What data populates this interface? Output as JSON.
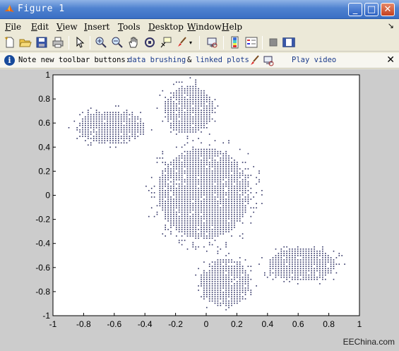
{
  "window": {
    "title": "Figure 1"
  },
  "menu": {
    "items": [
      "File",
      "Edit",
      "View",
      "Insert",
      "Tools",
      "Desktop",
      "Window",
      "Help"
    ]
  },
  "toolbar": {
    "icons": [
      "new-file-icon",
      "open-folder-icon",
      "save-icon",
      "print-icon",
      "pointer-arrow-icon",
      "zoom-in-icon",
      "zoom-out-icon",
      "pan-hand-icon",
      "rotate-3d-icon",
      "data-cursor-icon",
      "brush-icon",
      "link-plot-icon",
      "colorbar-icon",
      "legend-icon",
      "hide-plot-tools-icon",
      "show-plot-tools-icon"
    ]
  },
  "infobar": {
    "prefix": "Note new toolbar buttons:",
    "link1": "data brushing",
    "amp": "&",
    "link2": "linked plots",
    "link3": "Play video"
  },
  "colors": {
    "dots": "#2c2f62",
    "figure_bg": "#cccccc",
    "axes_bg": "#ffffff"
  },
  "chart_data": {
    "type": "scatter",
    "title": "",
    "xlabel": "",
    "ylabel": "",
    "xlim": [
      -1,
      1
    ],
    "ylim": [
      -1,
      1
    ],
    "xticks": [
      "-1",
      "-0.8",
      "-0.6",
      "-0.4",
      "-0.2",
      "0",
      "0.2",
      "0.4",
      "0.6",
      "0.8",
      "1"
    ],
    "yticks": [
      "1",
      "0.8",
      "0.6",
      "0.4",
      "0.2",
      "0",
      "-0.2",
      "-0.4",
      "-0.6",
      "-0.8",
      "-1"
    ],
    "grid": false,
    "regions": [
      {
        "name": "central body",
        "center": [
          -0.02,
          0.02
        ],
        "radii": [
          0.3,
          0.38
        ]
      },
      {
        "name": "upper-left lobe",
        "center": [
          -0.62,
          0.57
        ],
        "radii": [
          0.22,
          0.14
        ]
      },
      {
        "name": "upper lobe",
        "center": [
          -0.12,
          0.72
        ],
        "radii": [
          0.16,
          0.2
        ]
      },
      {
        "name": "lower-right lobe",
        "center": [
          0.62,
          -0.57
        ],
        "radii": [
          0.22,
          0.14
        ]
      },
      {
        "name": "lower lobe",
        "center": [
          0.12,
          -0.72
        ],
        "radii": [
          0.16,
          0.2
        ]
      }
    ]
  },
  "watermark": "EEChina.com"
}
